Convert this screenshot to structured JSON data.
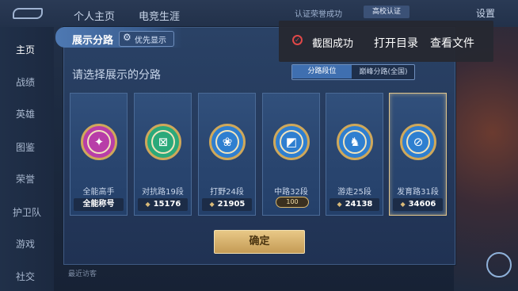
{
  "background": {
    "top_tabs": [
      "个人主页",
      "电竞生涯"
    ],
    "top_right": {
      "status": "认证荣誉成功",
      "cert": "高校认证",
      "settings": "设置"
    },
    "sidebar": [
      "主页",
      "战绩",
      "英雄",
      "图鉴",
      "荣誉",
      "护卫队",
      "游戏",
      "社交"
    ],
    "bottom_text": "最近访客"
  },
  "dialog": {
    "title": "展示分路",
    "priority_label": "优先显示",
    "subtitle": "请选择展示的分路",
    "tabs": [
      {
        "label": "分路段位",
        "selected": true
      },
      {
        "label": "巅峰分路(全国)",
        "selected": false
      }
    ],
    "cards": [
      {
        "name": "全能高手",
        "score": "全能称号",
        "badge_icon": "✦",
        "badge_color": "#b83ea8",
        "show_score_icon": false,
        "plate": ""
      },
      {
        "name": "对抗路19段",
        "score": "15176",
        "badge_icon": "⊠",
        "badge_color": "#2ba97a",
        "show_score_icon": true,
        "plate": ""
      },
      {
        "name": "打野24段",
        "score": "21905",
        "badge_icon": "❀",
        "badge_color": "#2f7fd0",
        "show_score_icon": true,
        "plate": ""
      },
      {
        "name": "中路32段",
        "score": "",
        "badge_icon": "◩",
        "badge_color": "#2f7fd0",
        "show_score_icon": false,
        "plate": "100"
      },
      {
        "name": "游走25段",
        "score": "24138",
        "badge_icon": "♞",
        "badge_color": "#2f7fd0",
        "show_score_icon": true,
        "plate": ""
      },
      {
        "name": "发育路31段",
        "score": "34606",
        "badge_icon": "⊘",
        "badge_color": "#2f7fd0",
        "show_score_icon": true,
        "plate": ""
      }
    ],
    "confirm_label": "确定"
  },
  "toast": {
    "message": "截图成功",
    "open_dir": "打开目录",
    "view_file": "查看文件"
  },
  "colors": {
    "gold": "#d9b76d",
    "selected_tab": "#3f6fb0",
    "toast_icon": "#e04848"
  }
}
